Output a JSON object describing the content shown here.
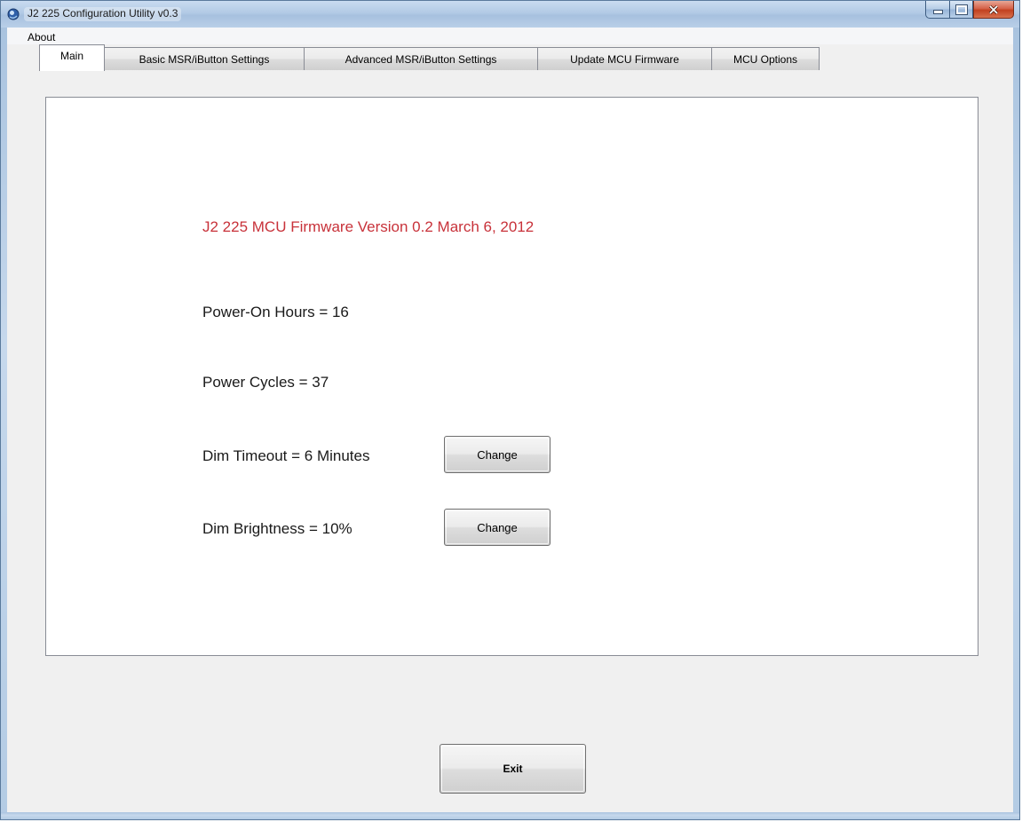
{
  "window": {
    "title": "J2 225 Configuration Utility  v0.3"
  },
  "menubar": {
    "items": [
      {
        "label": "About"
      }
    ]
  },
  "tabs": [
    {
      "label": "Main",
      "active": true
    },
    {
      "label": "Basic MSR/iButton Settings",
      "active": false
    },
    {
      "label": "Advanced MSR/iButton Settings",
      "active": false
    },
    {
      "label": "Update MCU Firmware",
      "active": false
    },
    {
      "label": "MCU Options",
      "active": false
    }
  ],
  "main": {
    "firmware_version": "J2 225 MCU Firmware Version 0.2 March 6, 2012",
    "power_on_hours": "Power-On Hours = 16",
    "power_cycles": "Power Cycles = 37",
    "dim_timeout": "Dim Timeout = 6 Minutes",
    "dim_timeout_button": "Change",
    "dim_brightness": "Dim Brightness = 10%",
    "dim_brightness_button": "Change"
  },
  "footer": {
    "exit_label": "Exit"
  },
  "colors": {
    "firmware_text": "#c8323a",
    "tab_page_bg": "#ffffff",
    "window_bg": "#f0f0f0"
  },
  "icons": {
    "app": "app-icon",
    "minimize": "minimize-icon",
    "maximize": "maximize-icon",
    "close": "close-icon"
  }
}
